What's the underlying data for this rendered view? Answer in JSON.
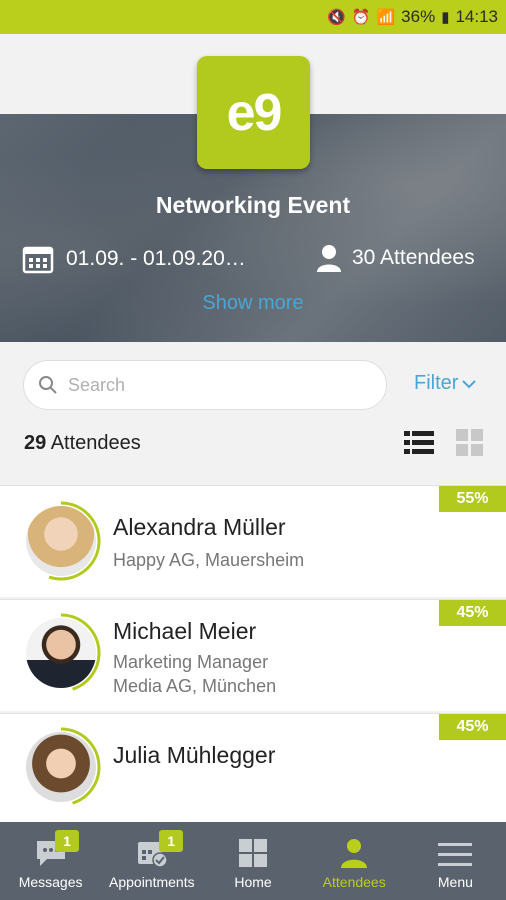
{
  "status_bar": {
    "battery": "36%",
    "time": "14:13"
  },
  "event": {
    "logo_text": "e9",
    "title": "Networking Event",
    "date": "01.09. - 01.09.20…",
    "attendees": "30 Attendees",
    "show_more": "Show more"
  },
  "search": {
    "placeholder": "Search",
    "filter_label": "Filter"
  },
  "list": {
    "count": "29",
    "count_label": " Attendees",
    "items": [
      {
        "name": "Alexandra Müller",
        "line1": "Happy AG, Mauersheim",
        "line2": "",
        "match": "55%",
        "match_value": 0.55
      },
      {
        "name": "Michael Meier",
        "line1": "Marketing Manager",
        "line2": "Media AG, München",
        "match": "45%",
        "match_value": 0.45
      },
      {
        "name": "Julia Mühlegger",
        "line1": "",
        "line2": "",
        "match": "45%",
        "match_value": 0.45
      }
    ]
  },
  "nav": {
    "messages": {
      "label": "Messages",
      "badge": "1"
    },
    "appointments": {
      "label": "Appointments",
      "badge": "1"
    },
    "home": {
      "label": "Home"
    },
    "attendees": {
      "label": "Attendees"
    },
    "menu": {
      "label": "Menu"
    }
  },
  "colors": {
    "accent": "#b2c91e",
    "link": "#4aa6d4",
    "nav_bg": "#5a636d"
  }
}
